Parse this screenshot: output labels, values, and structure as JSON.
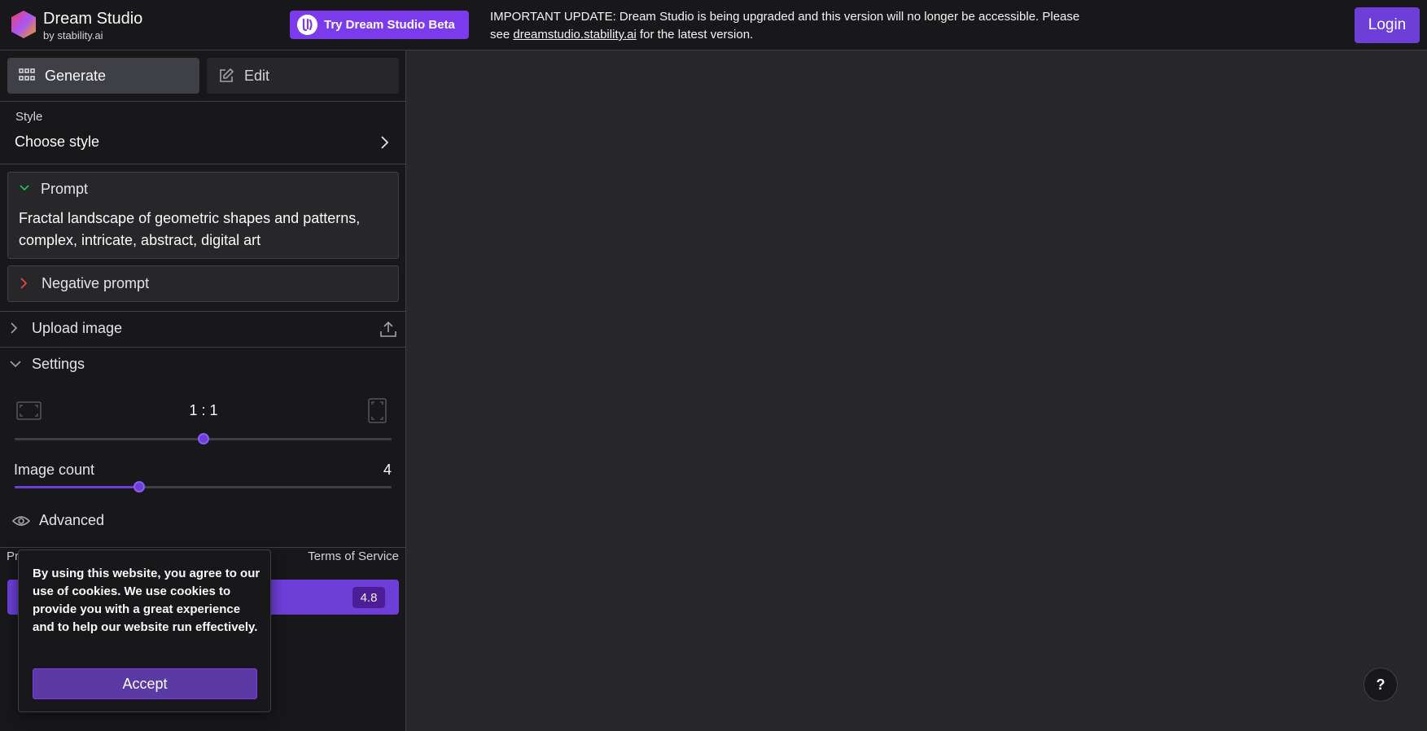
{
  "header": {
    "brand_title": "Dream Studio",
    "brand_sub": "by stability.ai",
    "beta_button": "Try Dream Studio Beta",
    "notice_line1": "IMPORTANT UPDATE: Dream Studio is being upgraded and this version will no longer be accessible. Please",
    "notice_prefix": "see ",
    "notice_link": "dreamstudio.stability.ai",
    "notice_suffix": " for the latest version.",
    "login_button": "Login"
  },
  "sidebar": {
    "tabs": [
      {
        "label": "Generate",
        "active": true
      },
      {
        "label": "Edit",
        "active": false
      }
    ],
    "style": {
      "label": "Style",
      "value": "Choose style"
    },
    "prompt": {
      "title": "Prompt",
      "text": "Fractal landscape of geometric shapes and patterns, complex, intricate, abstract, digital art"
    },
    "negative_prompt": {
      "title": "Negative prompt"
    },
    "upload_image": {
      "label": "Upload image"
    },
    "settings": {
      "label": "Settings",
      "aspect_ratio": "1 : 1",
      "aspect_ratio_level": 0.5,
      "image_count_label": "Image count",
      "image_count": "4",
      "image_count_level": 0.33,
      "advanced_label": "Advanced"
    },
    "footer": {
      "privacy_partial": "Pr",
      "terms": "Terms of Service",
      "cost": "4.8"
    }
  },
  "cookie": {
    "text": "By using this website, you agree to our use of cookies. We use cookies to provide you with a great experience and to help our website run effectively.",
    "accept": "Accept"
  },
  "help": {
    "label": "?"
  },
  "colors": {
    "accent": "#6d3fd8",
    "background": "#27272a",
    "sidebar_bg": "#18181b",
    "prompt_chevron": "#22c55e",
    "negative_chevron": "#ef4444"
  },
  "icons": [
    "grid-icon",
    "edit-icon",
    "chevron-right-icon",
    "chevron-down-icon",
    "upload-icon",
    "landscape-ratio-icon",
    "portrait-ratio-icon",
    "eye-icon"
  ]
}
